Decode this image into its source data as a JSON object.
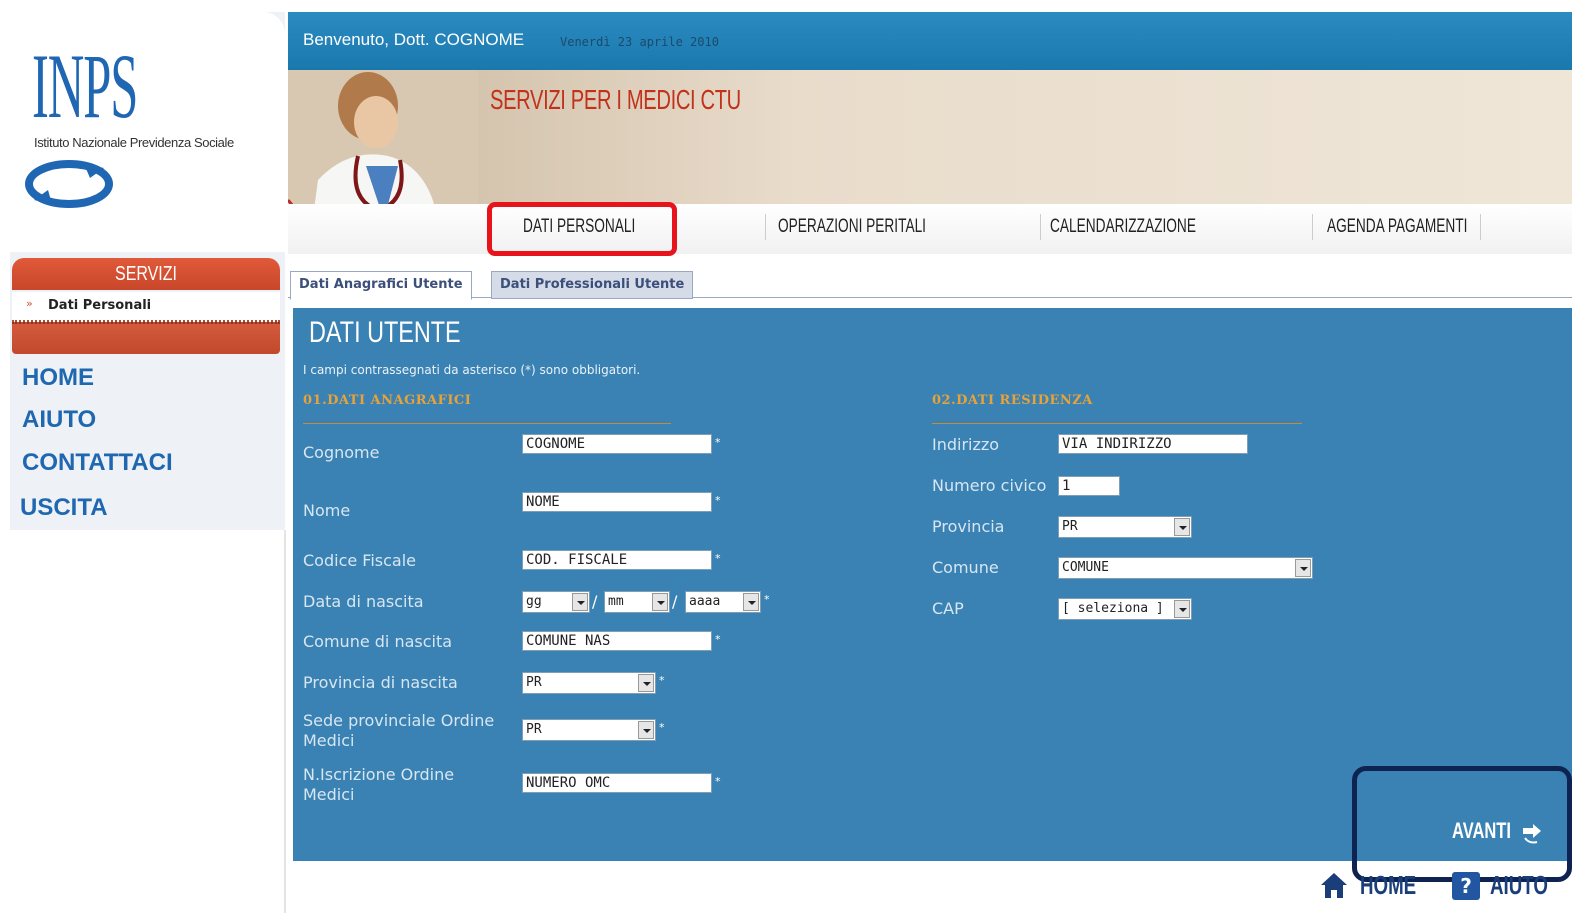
{
  "brand": {
    "logo": "INPS",
    "subtitle": "Istituto Nazionale Previdenza Sociale"
  },
  "header": {
    "welcome": "Benvenuto, Dott. COGNOME",
    "date": "Venerdì 23 aprile 2010",
    "title": "SERVIZI PER I MEDICI CTU"
  },
  "nav": {
    "tabs": [
      "DATI PERSONALI",
      "OPERAZIONI PERITALI",
      "CALENDARIZZAZIONE",
      "AGENDA PAGAMENTI"
    ],
    "highlight_color": "#e8141c"
  },
  "sidebar": {
    "servizi_title": "SERVIZI",
    "servizi_item": "Dati Personali",
    "links": [
      "HOME",
      "AIUTO",
      "CONTATTACI",
      "USCITA"
    ]
  },
  "subtabs": [
    "Dati Anagrafici Utente",
    "Dati Professionali Utente"
  ],
  "form": {
    "title": "DATI UTENTE",
    "note": "I campi contrassegnati da asterisco (*) sono obbligatori.",
    "section1": "01.DATI ANAGRAFICI",
    "section2": "02.DATI RESIDENZA",
    "anagrafici": {
      "cognome_label": "Cognome",
      "cognome_value": "COGNOME",
      "nome_label": "Nome",
      "nome_value": "NOME",
      "cf_label": "Codice Fiscale",
      "cf_value": "COD. FISCALE",
      "nascita_label": "Data di nascita",
      "gg": "gg",
      "mm": "mm",
      "aaaa": "aaaa",
      "comune_nascita_label": "Comune di nascita",
      "comune_nascita_value": "COMUNE NAS",
      "prov_nascita_label": "Provincia di nascita",
      "prov_nascita_value": "PR",
      "sede_label": "Sede provinciale Ordine Medici",
      "sede_value": "PR",
      "iscr_label": "N.Iscrizione Ordine Medici",
      "iscr_value": "NUMERO OMC"
    },
    "residenza": {
      "indirizzo_label": "Indirizzo",
      "indirizzo_value": "VIA INDIRIZZO",
      "civico_label": "Numero civico",
      "civico_value": "1",
      "provincia_label": "Provincia",
      "provincia_value": "PR",
      "comune_label": "Comune",
      "comune_value": "COMUNE",
      "cap_label": "CAP",
      "cap_value": "[ seleziona ]"
    },
    "required_mark": "*",
    "next_label": "AVANTI"
  },
  "footer": {
    "home": "HOME",
    "help": "AIUTO"
  },
  "colors": {
    "panel": "#3a82b4",
    "accent_orange": "#e8a23a",
    "frame_dark": "#0f2352"
  }
}
